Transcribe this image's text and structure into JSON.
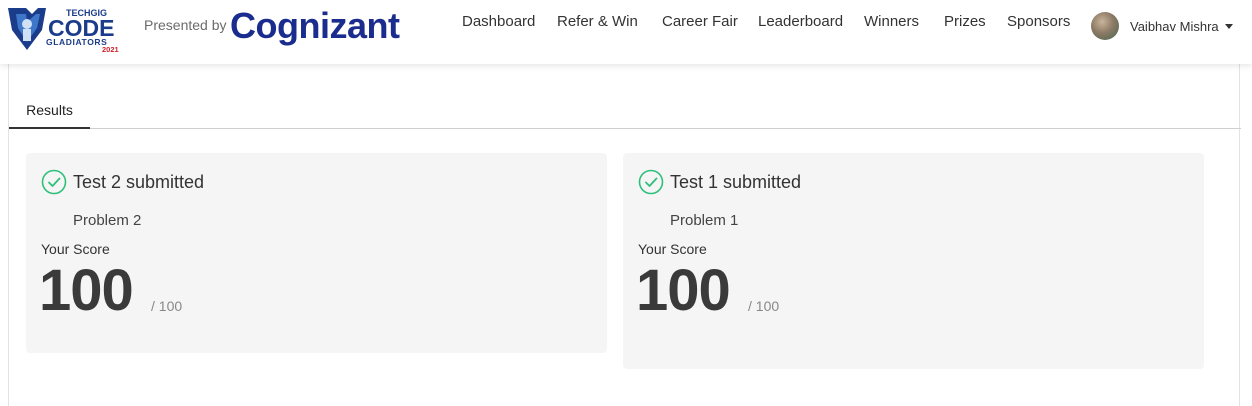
{
  "header": {
    "logo": {
      "top": "TECHGIG",
      "main": "CODE",
      "sub": "GLADIATORS",
      "year": "2021"
    },
    "presented_by": "Presented by",
    "sponsor": "Cognizant",
    "nav": [
      "Dashboard",
      "Refer & Win",
      "Career Fair",
      "Leaderboard",
      "Winners",
      "Prizes",
      "Sponsors"
    ],
    "user": {
      "name": "Vaibhav Mishra"
    }
  },
  "tabs": [
    {
      "label": "Results",
      "active": true
    }
  ],
  "results": [
    {
      "title": "Test 2 submitted",
      "problem": "Problem 2",
      "score_label": "Your Score",
      "score": "100",
      "max": "/ 100"
    },
    {
      "title": "Test 1 submitted",
      "problem": "Problem 1",
      "score_label": "Your Score",
      "score": "100",
      "max": "/ 100"
    }
  ],
  "colors": {
    "brand": "#1a2d8f",
    "check": "#2ec07a",
    "card_bg": "#f5f5f5"
  },
  "icons": {
    "status": "check-circle-icon",
    "user_menu": "caret-down-icon"
  }
}
